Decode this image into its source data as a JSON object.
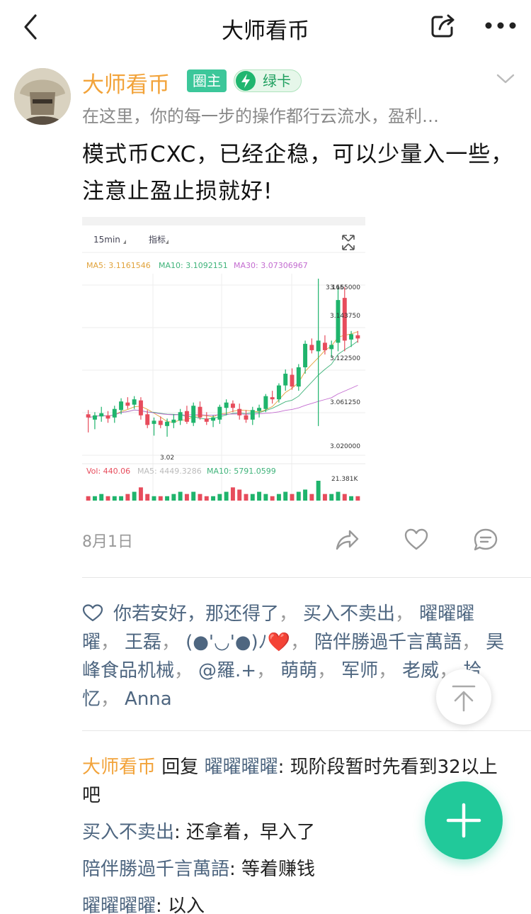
{
  "header": {
    "title": "大师看币"
  },
  "post": {
    "author": "大师看币",
    "badges": {
      "owner": "圈主",
      "card": "绿卡"
    },
    "bio": "在这里，你的每一步的操作都行云流水，盈利…",
    "text": "模式币CXC，已经企稳，可以少量入一些，注意止盈止损就好!",
    "date": "8月1日"
  },
  "chart_data": {
    "type": "candlestick",
    "interval": "15min",
    "indicator_label": "指标",
    "ma_labels": {
      "ma5": "MA5: 3.1161546",
      "ma10": "MA10: 3.1092151",
      "ma30": "MA30: 3.07306967"
    },
    "y_ticks": [
      "3.165000",
      "3.143750",
      "3.122500",
      "3.061250",
      "3.020000"
    ],
    "ylim": [
      3.0,
      3.17
    ],
    "max_label": "3.165",
    "min_label": "3.02",
    "candles": [
      [
        3.041,
        3.045,
        3.024,
        3.038
      ],
      [
        3.036,
        3.043,
        3.027,
        3.04
      ],
      [
        3.039,
        3.048,
        3.034,
        3.042
      ],
      [
        3.04,
        3.044,
        3.033,
        3.037
      ],
      [
        3.038,
        3.049,
        3.033,
        3.046
      ],
      [
        3.045,
        3.056,
        3.041,
        3.053
      ],
      [
        3.052,
        3.057,
        3.046,
        3.049
      ],
      [
        3.05,
        3.058,
        3.046,
        3.055
      ],
      [
        3.054,
        3.057,
        3.036,
        3.04
      ],
      [
        3.041,
        3.045,
        3.028,
        3.031
      ],
      [
        3.032,
        3.038,
        3.021,
        3.035
      ],
      [
        3.035,
        3.039,
        3.028,
        3.031
      ],
      [
        3.03,
        3.037,
        3.02,
        3.034
      ],
      [
        3.033,
        3.041,
        3.028,
        3.036
      ],
      [
        3.035,
        3.046,
        3.031,
        3.043
      ],
      [
        3.044,
        3.049,
        3.032,
        3.034
      ],
      [
        3.033,
        3.052,
        3.03,
        3.049
      ],
      [
        3.048,
        3.053,
        3.036,
        3.038
      ],
      [
        3.037,
        3.043,
        3.031,
        3.034
      ],
      [
        3.035,
        3.04,
        3.029,
        3.038
      ],
      [
        3.036,
        3.05,
        3.032,
        3.048
      ],
      [
        3.047,
        3.055,
        3.04,
        3.052
      ],
      [
        3.051,
        3.054,
        3.043,
        3.047
      ],
      [
        3.046,
        3.051,
        3.036,
        3.04
      ],
      [
        3.04,
        3.045,
        3.033,
        3.036
      ],
      [
        3.036,
        3.048,
        3.031,
        3.045
      ],
      [
        3.044,
        3.05,
        3.038,
        3.047
      ],
      [
        3.046,
        3.06,
        3.043,
        3.058
      ],
      [
        3.057,
        3.063,
        3.051,
        3.055
      ],
      [
        3.055,
        3.07,
        3.052,
        3.068
      ],
      [
        3.068,
        3.083,
        3.063,
        3.079
      ],
      [
        3.078,
        3.084,
        3.064,
        3.067
      ],
      [
        3.067,
        3.088,
        3.063,
        3.085
      ],
      [
        3.085,
        3.11,
        3.079,
        3.107
      ],
      [
        3.106,
        3.112,
        3.098,
        3.101
      ],
      [
        3.1,
        3.168,
        3.03,
        3.11
      ],
      [
        3.108,
        3.115,
        3.097,
        3.101
      ],
      [
        3.102,
        3.11,
        3.094,
        3.106
      ],
      [
        3.108,
        3.16,
        3.1,
        3.148
      ],
      [
        3.15,
        3.16,
        3.1,
        3.11
      ],
      [
        3.111,
        3.119,
        3.104,
        3.116
      ],
      [
        3.115,
        3.119,
        3.108,
        3.112
      ]
    ],
    "vol_labels": {
      "vol": "Vol: 440.06",
      "ma5": "MA5: 4449.3286",
      "ma10": "MA10: 5791.0599"
    },
    "vol_max_label": "21.381K",
    "volumes": [
      2,
      2,
      3,
      2,
      2,
      2,
      3,
      4,
      6,
      3,
      2,
      2,
      2,
      3,
      4,
      3,
      4,
      3,
      2,
      2,
      3,
      4,
      6,
      5,
      3,
      3,
      4,
      3,
      2,
      3,
      4,
      3,
      4,
      5,
      3,
      9,
      3,
      3,
      4,
      3,
      2,
      2
    ]
  },
  "likes": {
    "names": [
      "你若安好，那还得了",
      "买入不卖出",
      "曜曜曜曜",
      "王磊",
      "(●'◡'●)ﾉ❤️",
      "陪伴勝過千言萬語",
      "昊峰食品机械",
      "@羅.+",
      "萌萌",
      "军师",
      "老威",
      "拾忆",
      "Anna"
    ]
  },
  "comments": [
    {
      "author": "大师看币",
      "is_owner": true,
      "reply_word": "回复",
      "reply_to": "曜曜曜曜",
      "text": "现阶段暂时先看到32以上吧"
    },
    {
      "author": "买入不卖出",
      "text": "还拿着，早入了"
    },
    {
      "author": "陪伴勝過千言萬語",
      "text": "等着赚钱"
    },
    {
      "author": "曜曜曜曜",
      "text": "以入"
    }
  ],
  "colors": {
    "accent": "#21c99a",
    "up": "#e74c5c",
    "down": "#1fb46c",
    "owner": "#f2a33a"
  }
}
